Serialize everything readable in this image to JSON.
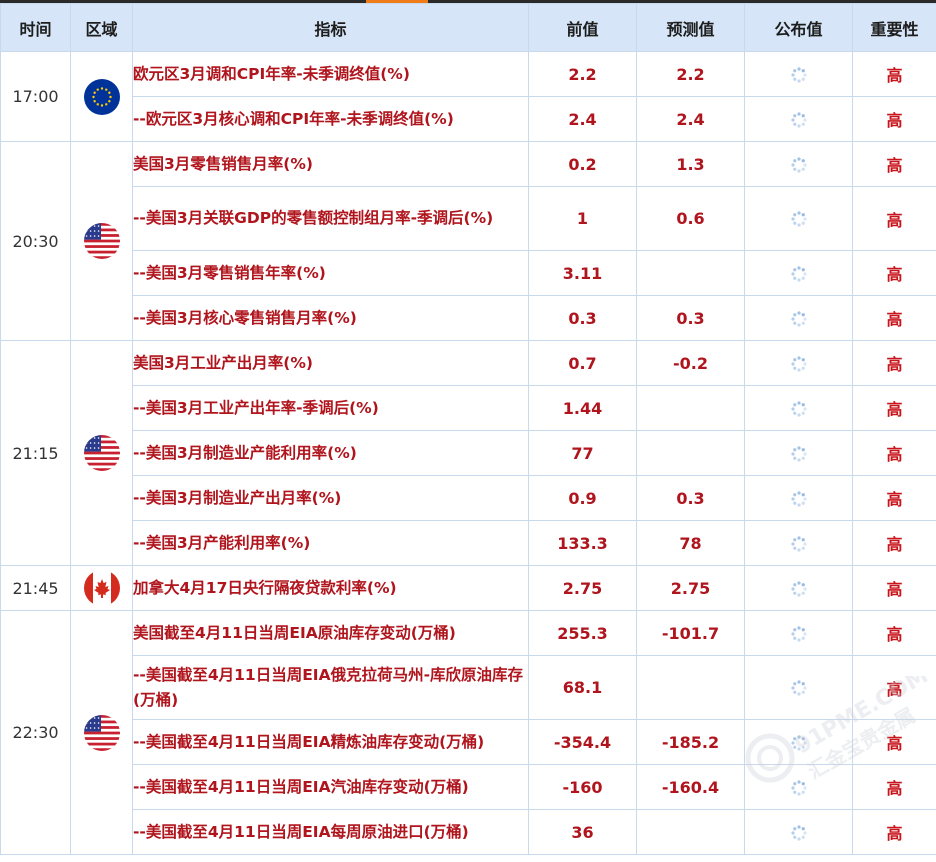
{
  "header": {
    "time": "时间",
    "region": "区域",
    "indicator": "指标",
    "previous": "前值",
    "forecast": "预测值",
    "actual": "公布值",
    "importance": "重要性"
  },
  "groups": [
    {
      "time": "17:00",
      "flag": "eu-flag",
      "rows": [
        {
          "indicator": "欧元区3月调和CPI年率-未季调终值(%)",
          "previous": "2.2",
          "forecast": "2.2",
          "importance": "高"
        },
        {
          "indicator": "--欧元区3月核心调和CPI年率-未季调终值(%)",
          "previous": "2.4",
          "forecast": "2.4",
          "importance": "高"
        }
      ]
    },
    {
      "time": "20:30",
      "flag": "us-flag",
      "rows": [
        {
          "indicator": "美国3月零售销售月率(%)",
          "previous": "0.2",
          "forecast": "1.3",
          "importance": "高"
        },
        {
          "indicator": "--美国3月关联GDP的零售额控制组月率-季调后(%)",
          "previous": "1",
          "forecast": "0.6",
          "importance": "高"
        },
        {
          "indicator": "--美国3月零售销售年率(%)",
          "previous": "3.11",
          "forecast": "",
          "importance": "高"
        },
        {
          "indicator": "--美国3月核心零售销售月率(%)",
          "previous": "0.3",
          "forecast": "0.3",
          "importance": "高"
        }
      ]
    },
    {
      "time": "21:15",
      "flag": "us-flag",
      "rows": [
        {
          "indicator": "美国3月工业产出月率(%)",
          "previous": "0.7",
          "forecast": "-0.2",
          "importance": "高"
        },
        {
          "indicator": "--美国3月工业产出年率-季调后(%)",
          "previous": "1.44",
          "forecast": "",
          "importance": "高"
        },
        {
          "indicator": "--美国3月制造业产能利用率(%)",
          "previous": "77",
          "forecast": "",
          "importance": "高"
        },
        {
          "indicator": "--美国3月制造业产出月率(%)",
          "previous": "0.9",
          "forecast": "0.3",
          "importance": "高"
        },
        {
          "indicator": "--美国3月产能利用率(%)",
          "previous": "133.3",
          "forecast": "78",
          "importance": "高"
        }
      ]
    },
    {
      "time": "21:45",
      "flag": "ca-flag",
      "rows": [
        {
          "indicator": "加拿大4月17日央行隔夜贷款利率(%)",
          "previous": "2.75",
          "forecast": "2.75",
          "importance": "高"
        }
      ]
    },
    {
      "time": "22:30",
      "flag": "us-flag",
      "rows": [
        {
          "indicator": "美国截至4月11日当周EIA原油库存变动(万桶)",
          "previous": "255.3",
          "forecast": "-101.7",
          "importance": "高"
        },
        {
          "indicator": "--美国截至4月11日当周EIA俄克拉荷马州-库欣原油库存(万桶)",
          "previous": "68.1",
          "forecast": "",
          "importance": "高"
        },
        {
          "indicator": "--美国截至4月11日当周EIA精炼油库存变动(万桶)",
          "previous": "-354.4",
          "forecast": "-185.2",
          "importance": "高"
        },
        {
          "indicator": "--美国截至4月11日当周EIA汽油库存变动(万桶)",
          "previous": "-160",
          "forecast": "-160.4",
          "importance": "高"
        },
        {
          "indicator": "--美国截至4月11日当周EIA每周原油进口(万桶)",
          "previous": "36",
          "forecast": "",
          "importance": "高"
        }
      ]
    }
  ],
  "watermark": {
    "line1": "91PME.COM",
    "line2": "汇金宝贵金属"
  },
  "colors": {
    "header_bg": "#d6e6f8",
    "value_red": "#b0141c",
    "border": "#c9d9ec",
    "accent_orange": "#f07b19"
  }
}
